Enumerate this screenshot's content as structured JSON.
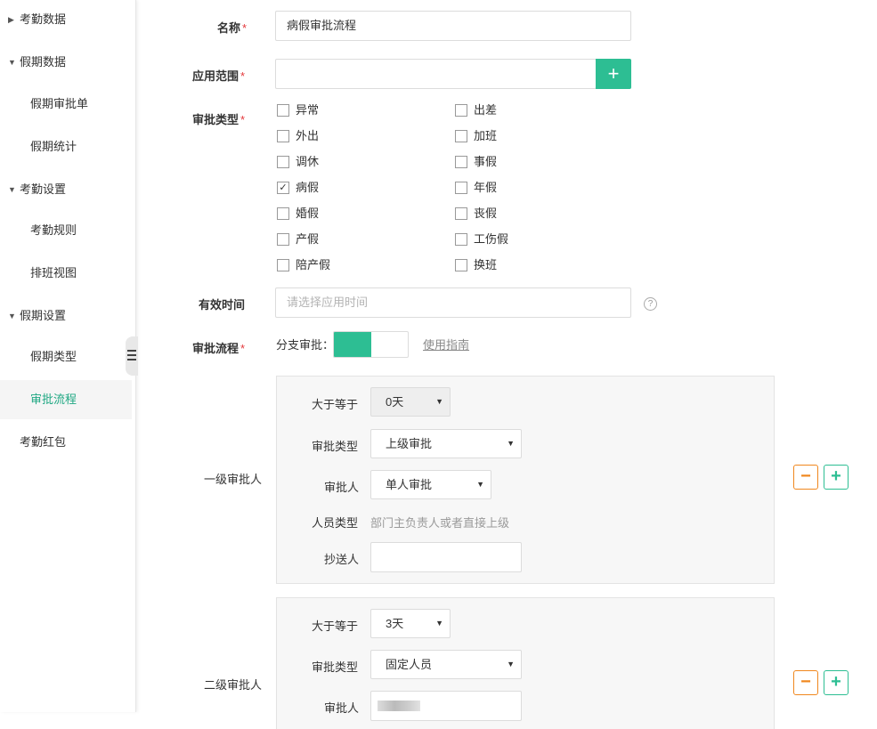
{
  "sidebar": {
    "items": [
      {
        "label": "考勤数据",
        "caret": "▶"
      },
      {
        "label": "假期数据",
        "caret": "▼"
      },
      {
        "label": "假期审批单"
      },
      {
        "label": "假期统计"
      },
      {
        "label": "考勤设置",
        "caret": "▼"
      },
      {
        "label": "考勤规则"
      },
      {
        "label": "排班视图"
      },
      {
        "label": "假期设置",
        "caret": "▼"
      },
      {
        "label": "假期类型"
      },
      {
        "label": "审批流程"
      },
      {
        "label": "考勤红包"
      }
    ],
    "active_item": "审批流程"
  },
  "form": {
    "name_label": "名称",
    "name_value": "病假审批流程",
    "scope_label": "应用范围",
    "scope_add": "+",
    "type_label": "审批类型",
    "types_left": [
      {
        "label": "异常",
        "checked": false
      },
      {
        "label": "外出",
        "checked": false
      },
      {
        "label": "调休",
        "checked": false
      },
      {
        "label": "病假",
        "checked": true
      },
      {
        "label": "婚假",
        "checked": false
      },
      {
        "label": "产假",
        "checked": false
      },
      {
        "label": "陪产假",
        "checked": false
      }
    ],
    "types_right": [
      {
        "label": "出差",
        "checked": false
      },
      {
        "label": "加班",
        "checked": false
      },
      {
        "label": "事假",
        "checked": false
      },
      {
        "label": "年假",
        "checked": false
      },
      {
        "label": "丧假",
        "checked": false
      },
      {
        "label": "工伤假",
        "checked": false
      },
      {
        "label": "换班",
        "checked": false
      }
    ],
    "check_mark": "✓",
    "valid_label": "有效时间",
    "valid_placeholder": "请选择应用时间",
    "help_icon": "?",
    "flow_label": "审批流程",
    "branch_label": "分支审批：",
    "branch_enabled": true,
    "guide_link": "使用指南",
    "required_mark": "*"
  },
  "levels": [
    {
      "title": "一级审批人",
      "gte_label": "大于等于",
      "gte_value": "0天",
      "approval_type_label": "审批类型",
      "approval_type_value": "上级审批",
      "approver_label": "审批人",
      "approver_value": "单人审批",
      "person_type_label": "人员类型",
      "person_type_value": "部门主负责人或者直接上级",
      "cc_label": "抄送人",
      "cc_value": ""
    },
    {
      "title": "二级审批人",
      "gte_label": "大于等于",
      "gte_value": "3天",
      "approval_type_label": "审批类型",
      "approval_type_value": "固定人员",
      "approver_label": "审批人"
    }
  ],
  "buttons": {
    "minus": "−",
    "plus": "+"
  },
  "dropdown_arrow": "▼",
  "colors": {
    "accent": "#2dbe93",
    "active_text": "#20a883",
    "minus": "#f0871e",
    "required": "#e4393c"
  }
}
